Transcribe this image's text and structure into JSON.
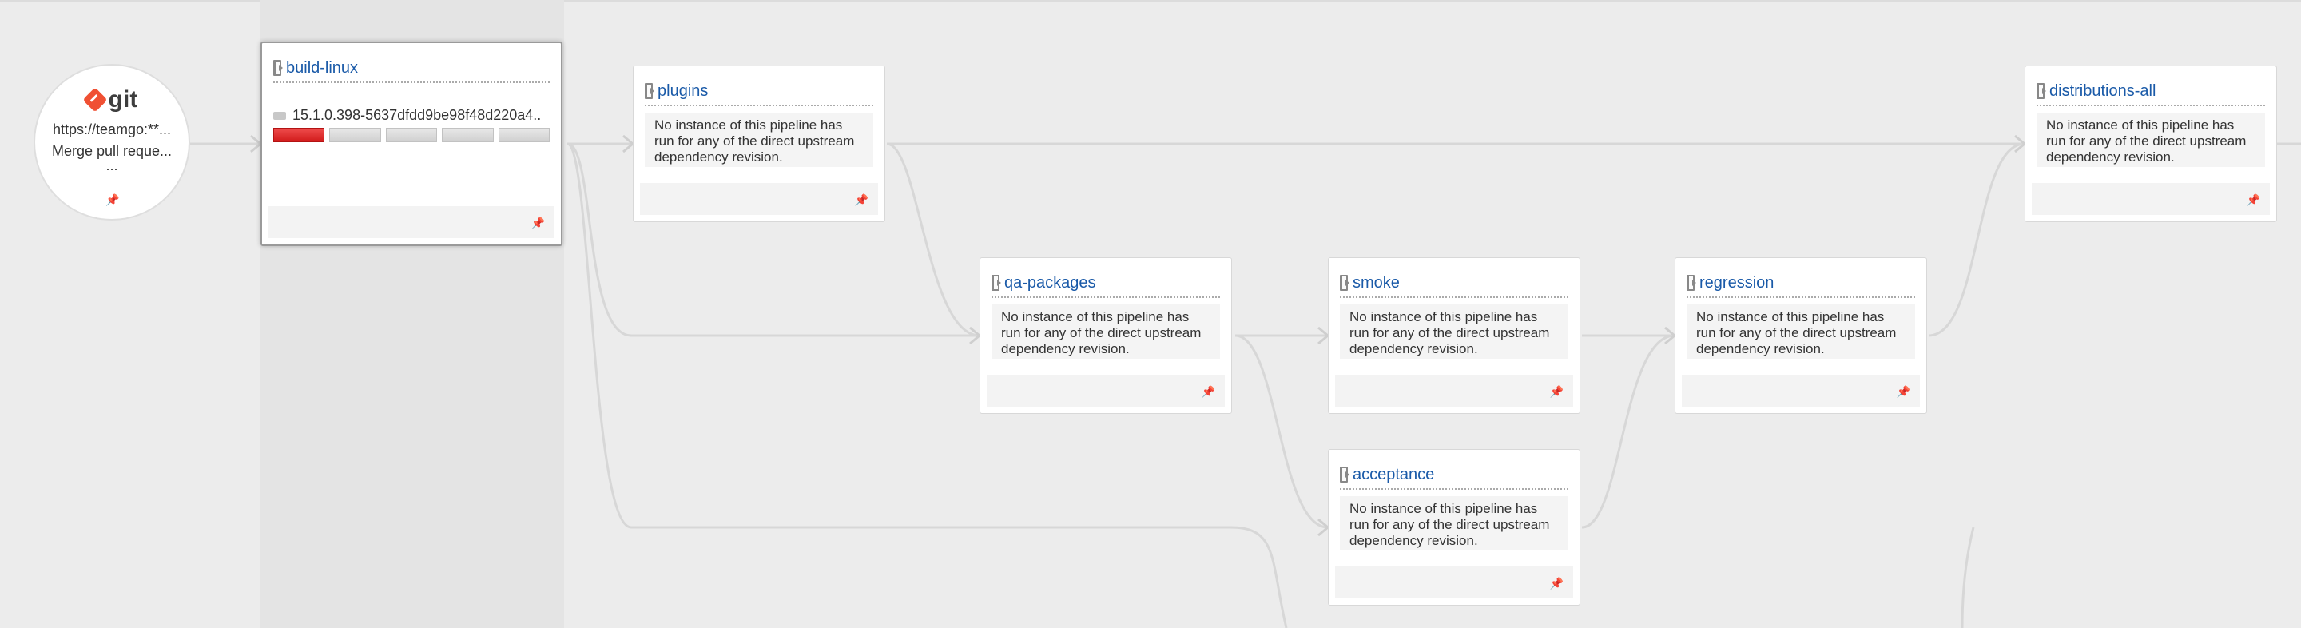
{
  "material": {
    "logo_text": "git",
    "url": "https://teamgo:**...",
    "message": "Merge pull reque...",
    "more": "..."
  },
  "selected_pipeline": {
    "name": "build-linux",
    "revision": "15.1.0.398-5637dfdd9be98f48d220a4..",
    "stages": [
      "failed",
      "pending",
      "pending",
      "pending",
      "pending"
    ]
  },
  "pipelines": {
    "plugins": {
      "name": "plugins",
      "message": "No instance of this pipeline has run for any of the direct upstream dependency revision."
    },
    "qa_packages": {
      "name": "qa-packages",
      "message": "No instance of this pipeline has run for any of the direct upstream dependency revision."
    },
    "smoke": {
      "name": "smoke",
      "message": "No instance of this pipeline has run for any of the direct upstream dependency revision."
    },
    "regression": {
      "name": "regression",
      "message": "No instance of this pipeline has run for any of the direct upstream dependency revision."
    },
    "acceptance": {
      "name": "acceptance",
      "message": "No instance of this pipeline has run for any of the direct upstream dependency revision."
    },
    "distributions_all": {
      "name": "distributions-all",
      "message": "No instance of this pipeline has run for any of the direct upstream dependency revision."
    }
  },
  "colors": {
    "link": "#1a5aa8",
    "failed_stage": "#d21b1b",
    "git_brand": "#f05033"
  }
}
